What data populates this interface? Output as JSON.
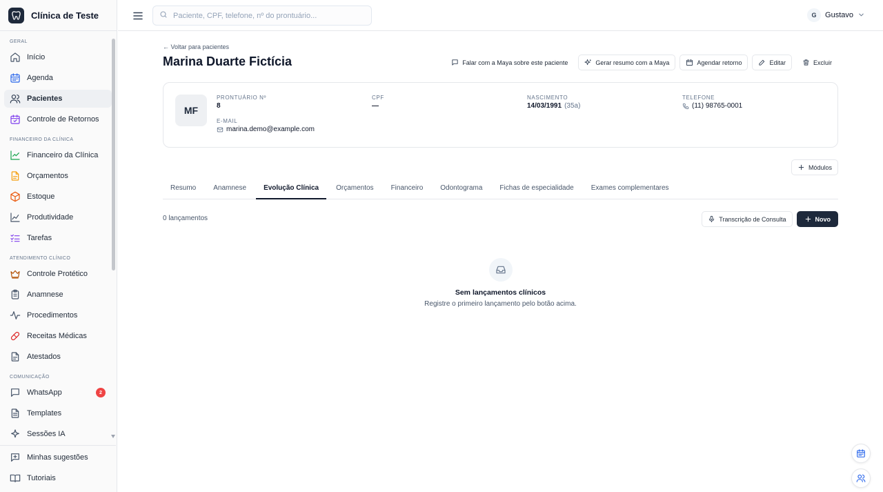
{
  "brand": {
    "name": "Clínica de Teste"
  },
  "sidebar": {
    "sections": [
      {
        "title": "Geral",
        "items": [
          {
            "label": "Início",
            "icon": "home-icon",
            "color": "#475569"
          },
          {
            "label": "Agenda",
            "icon": "calendar-icon",
            "color": "#2563eb"
          },
          {
            "label": "Pacientes",
            "icon": "users-icon",
            "color": "#334155",
            "active": true
          },
          {
            "label": "Controle de Retornos",
            "icon": "calendar-check-icon",
            "color": "#7c3aed"
          }
        ]
      },
      {
        "title": "Financeiro da Clínica",
        "items": [
          {
            "label": "Financeiro da Clínica",
            "icon": "trend-chart-icon",
            "color": "#16a34a"
          },
          {
            "label": "Orçamentos",
            "icon": "document-icon",
            "color": "#f59e0b"
          },
          {
            "label": "Estoque",
            "icon": "box-icon",
            "color": "#ea580c"
          },
          {
            "label": "Produtividade",
            "icon": "line-chart-icon",
            "color": "#475569"
          },
          {
            "label": "Tarefas",
            "icon": "checklist-icon",
            "color": "#7c3aed"
          }
        ]
      },
      {
        "title": "Atendimento Clínico",
        "items": [
          {
            "label": "Controle Protético",
            "icon": "crown-icon",
            "color": "#b45309"
          },
          {
            "label": "Anamnese",
            "icon": "clipboard-icon",
            "color": "#475569"
          },
          {
            "label": "Procedimentos",
            "icon": "activity-icon",
            "color": "#475569"
          },
          {
            "label": "Receitas Médicas",
            "icon": "pill-icon",
            "color": "#dc2626"
          },
          {
            "label": "Atestados",
            "icon": "file-icon",
            "color": "#475569"
          }
        ]
      },
      {
        "title": "Comunicação",
        "items": [
          {
            "label": "WhatsApp",
            "icon": "chat-icon",
            "color": "#475569",
            "badge": "2"
          },
          {
            "label": "Templates",
            "icon": "file-text-icon",
            "color": "#475569"
          },
          {
            "label": "Sessões IA",
            "icon": "sparkle-icon",
            "color": "#475569"
          }
        ]
      }
    ],
    "footer": [
      {
        "label": "Minhas sugestões",
        "icon": "suggestion-icon"
      },
      {
        "label": "Tutoriais",
        "icon": "book-icon"
      }
    ]
  },
  "topbar": {
    "search_placeholder": "Paciente, CPF, telefone, nº do prontuário...",
    "user_initial": "G",
    "user_name": "Gustavo"
  },
  "patient": {
    "back_label": "← Voltar para pacientes",
    "name": "Marina Duarte Fictícia",
    "initials": "MF",
    "actions": {
      "maya_chat": "Falar com a Maya sobre este paciente",
      "maya_summary": "Gerar resumo com a Maya",
      "schedule": "Agendar retorno",
      "edit": "Editar",
      "delete": "Excluir"
    },
    "fields": {
      "record_label": "Prontuário Nº",
      "record_value": "8",
      "cpf_label": "CPF",
      "cpf_value": "—",
      "birth_label": "Nascimento",
      "birth_value": "14/03/1991",
      "birth_age": "(35a)",
      "phone_label": "Telefone",
      "phone_value": "(11) 98765-0001",
      "email_label": "E-mail",
      "email_value": "marina.demo@example.com"
    }
  },
  "modules_label": "Módulos",
  "tabs": [
    {
      "label": "Resumo"
    },
    {
      "label": "Anamnese"
    },
    {
      "label": "Evolução Clínica",
      "active": true
    },
    {
      "label": "Orçamentos"
    },
    {
      "label": "Financeiro"
    },
    {
      "label": "Odontograma"
    },
    {
      "label": "Fichas de especialidade"
    },
    {
      "label": "Exames complementares"
    }
  ],
  "entries": {
    "count": "0 lançamentos",
    "transcription_label": "Transcrição de Consulta",
    "new_label": "Novo",
    "empty_title": "Sem lançamentos clínicos",
    "empty_subtitle": "Registre o primeiro lançamento pelo botão acima."
  }
}
